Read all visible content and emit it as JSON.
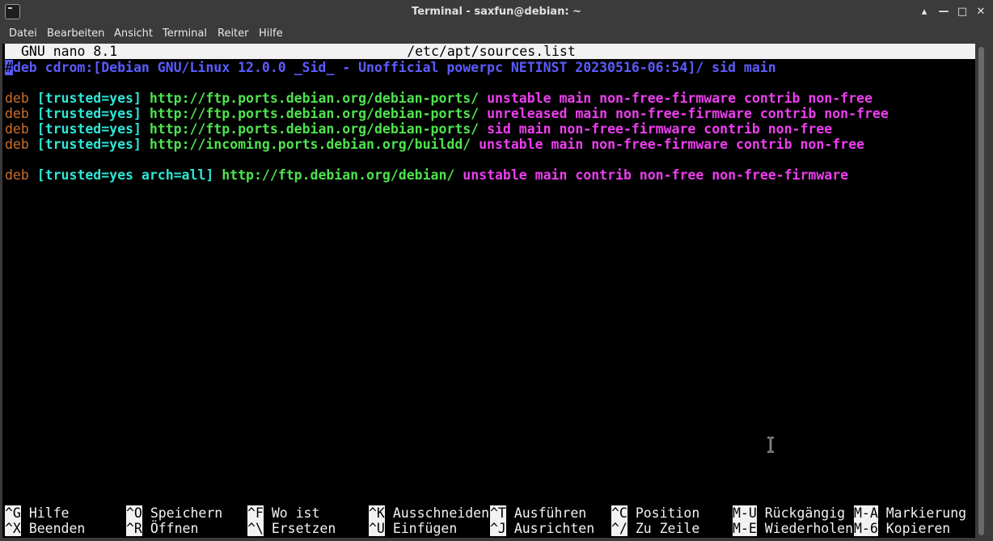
{
  "window": {
    "title": "Terminal - saxfun@debian: ~",
    "controls": {
      "up": "▴",
      "minimize": "—",
      "maximize": "□",
      "close": "✕"
    }
  },
  "menu": [
    "Datei",
    "Bearbeiten",
    "Ansicht",
    "Terminal",
    "Reiter",
    "Hilfe"
  ],
  "nano": {
    "version": "GNU nano 8.1",
    "filename": "/etc/apt/sources.list"
  },
  "lines": [
    {
      "comment_cursor": "#",
      "comment_rest": "deb cdrom:[Debian GNU/Linux 12.0.0 _Sid_ - Unofficial powerpc NETINST 20230516-06:54]/ sid main"
    },
    {
      "deb": "deb",
      "options": "[trusted=yes]",
      "url": "http://ftp.ports.debian.org/debian-ports/",
      "components": "unstable main non-free-firmware contrib non-free"
    },
    {
      "deb": "deb",
      "options": "[trusted=yes]",
      "url": "http://ftp.ports.debian.org/debian-ports/",
      "components": "unreleased main non-free-firmware contrib non-free"
    },
    {
      "deb": "deb",
      "options": "[trusted=yes]",
      "url": "http://ftp.ports.debian.org/debian-ports/",
      "components": "sid main non-free-firmware contrib non-free"
    },
    {
      "deb": "deb",
      "options": "[trusted=yes]",
      "url": "http://incoming.ports.debian.org/buildd/",
      "components": "unstable main non-free-firmware contrib non-free"
    },
    {
      "deb": "deb",
      "options": "[trusted=yes arch=all]",
      "url": "http://ftp.debian.org/debian/",
      "components": "unstable main contrib non-free non-free-firmware"
    }
  ],
  "shortcuts_row1": [
    {
      "key": "^G",
      "label": "Hilfe"
    },
    {
      "key": "^O",
      "label": "Speichern"
    },
    {
      "key": "^F",
      "label": "Wo ist"
    },
    {
      "key": "^K",
      "label": "Ausschneiden"
    },
    {
      "key": "^T",
      "label": "Ausführen"
    },
    {
      "key": "^C",
      "label": "Position"
    },
    {
      "key": "M-U",
      "label": "Rückgängig"
    },
    {
      "key": "M-A",
      "label": "Markierung"
    }
  ],
  "shortcuts_row2": [
    {
      "key": "^X",
      "label": "Beenden"
    },
    {
      "key": "^R",
      "label": "Öffnen"
    },
    {
      "key": "^\\",
      "label": "Ersetzen"
    },
    {
      "key": "^U",
      "label": "Einfügen"
    },
    {
      "key": "^J",
      "label": "Ausrichten"
    },
    {
      "key": "^/",
      "label": "Zu Zeile"
    },
    {
      "key": "M-E",
      "label": "Wiederholen"
    },
    {
      "key": "M-6",
      "label": "Kopieren"
    }
  ],
  "icons": {
    "app": "terminal-icon",
    "pointer": "text-cursor-icon"
  }
}
